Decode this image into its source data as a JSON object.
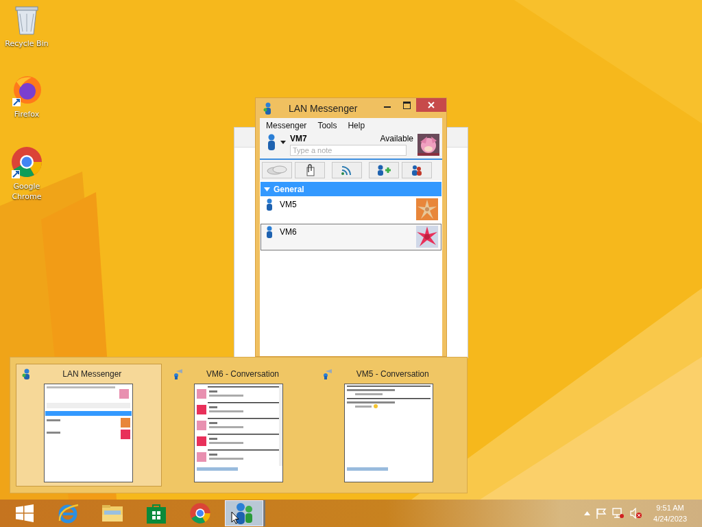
{
  "desktop_icons": [
    {
      "label": "Recycle Bin",
      "kind": "bin"
    },
    {
      "label": "Firefox",
      "kind": "firefox"
    },
    {
      "label": "Google Chrome",
      "kind": "chrome"
    }
  ],
  "window": {
    "title": "LAN Messenger",
    "menu": [
      "Messenger",
      "Tools",
      "Help"
    ],
    "user": {
      "name": "VM7",
      "status": "Available",
      "note_placeholder": "Type a note"
    },
    "group": {
      "label": "General",
      "expanded": true,
      "contacts": [
        {
          "name": "VM5",
          "selected": false
        },
        {
          "name": "VM6",
          "selected": true
        }
      ]
    }
  },
  "thumbnails": [
    {
      "title": "LAN Messenger",
      "selected": true,
      "kind": "messenger"
    },
    {
      "title": "VM6 - Conversation",
      "selected": false,
      "kind": "chat"
    },
    {
      "title": "VM5 - Conversation",
      "selected": false,
      "kind": "broadcast"
    }
  ],
  "taskbar": {
    "apps": [
      {
        "kind": "ie",
        "selected": false
      },
      {
        "kind": "explorer",
        "selected": false
      },
      {
        "kind": "store",
        "selected": false
      },
      {
        "kind": "chrome",
        "selected": false
      },
      {
        "kind": "messenger",
        "selected": true
      }
    ],
    "time": "9:51 AM",
    "date": "4/24/2023"
  }
}
